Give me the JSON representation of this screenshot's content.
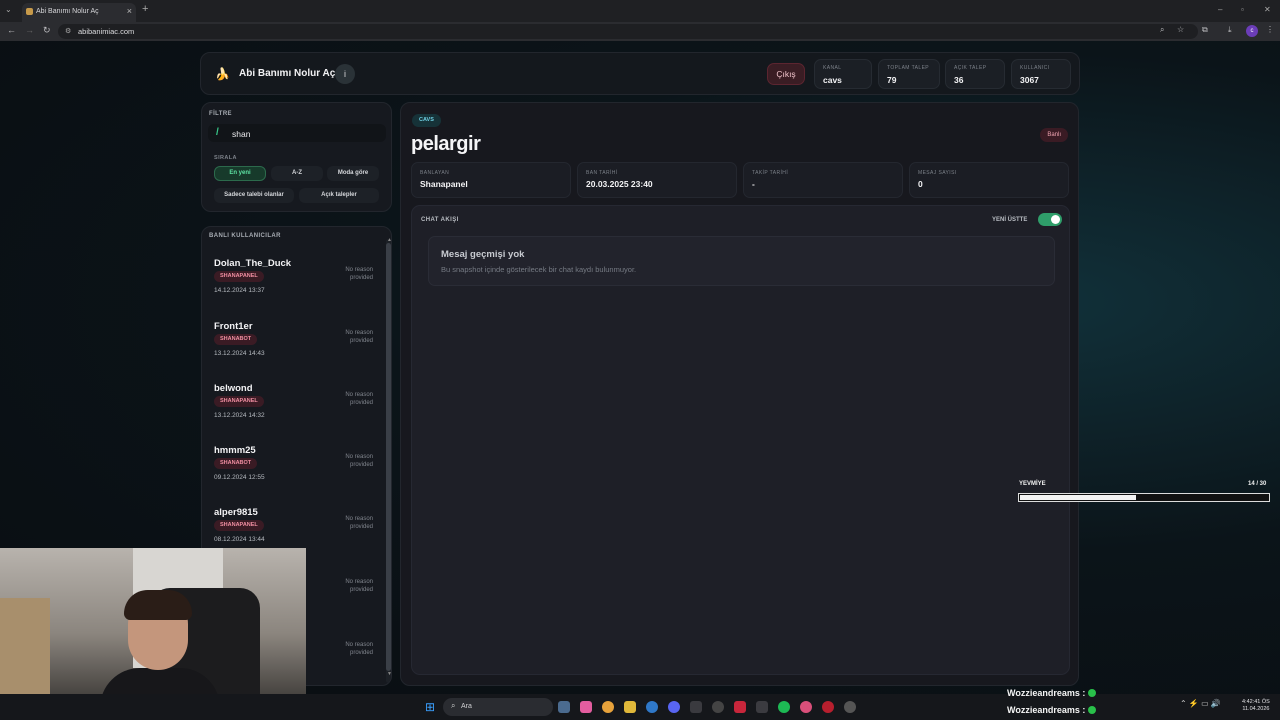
{
  "browser": {
    "tab_title": "Abi Banımı Nolur Aç",
    "url": "abibanimiac.com"
  },
  "header": {
    "emoji": "🍌",
    "title": "Abi Banımı Nolur Aç",
    "info_label": "i",
    "logout_label": "Çıkış",
    "stats": [
      {
        "label": "KANAL",
        "value": "cavs"
      },
      {
        "label": "TOPLAM TALEP",
        "value": "79"
      },
      {
        "label": "AÇIK TALEP",
        "value": "36"
      },
      {
        "label": "KULLANICI",
        "value": "3067"
      }
    ]
  },
  "filter": {
    "title": "FİLTRE",
    "prefix": "/",
    "value": "shan",
    "sort_title": "SIRALA",
    "sort_options": [
      "En yeni",
      "A-Z",
      "Moda göre"
    ],
    "active_sort": "En yeni",
    "extra_options": [
      "Sadece talebi olanlar",
      "Açık talepler"
    ]
  },
  "banned_users": {
    "title": "BANLI KULLANICILAR",
    "items": [
      {
        "name": "Dolan_The_Duck",
        "source": "SHANAPANEL",
        "date": "14.12.2024 13:37",
        "reason": "No reason provided"
      },
      {
        "name": "Front1er",
        "source": "SHANABOT",
        "date": "13.12.2024 14:43",
        "reason": "No reason provided"
      },
      {
        "name": "belwond",
        "source": "SHANAPANEL",
        "date": "13.12.2024 14:32",
        "reason": "No reason provided"
      },
      {
        "name": "hmmm25",
        "source": "SHANABOT",
        "date": "09.12.2024 12:55",
        "reason": "No reason provided"
      },
      {
        "name": "alper9815",
        "source": "SHANAPANEL",
        "date": "08.12.2024 13:44",
        "reason": "No reason provided"
      },
      {
        "name": "",
        "source": "",
        "date": "",
        "reason": "No reason provided"
      },
      {
        "name": "",
        "source": "",
        "date": "",
        "reason": "No reason provided"
      }
    ]
  },
  "detail": {
    "channel": "CAVS",
    "status": "Banlı",
    "username": "pelargir",
    "info": [
      {
        "label": "BANLAYAN",
        "value": "Shanapanel"
      },
      {
        "label": "BAN TARİHİ",
        "value": "20.03.2025 23:40"
      },
      {
        "label": "TAKİP TARİHİ",
        "value": "-"
      },
      {
        "label": "MESAJ SAYISI",
        "value": "0"
      }
    ],
    "chat": {
      "title": "CHAT AKIŞI",
      "newest_first_label": "YENİ ÜSTTE",
      "newest_first": true,
      "empty_title": "Mesaj geçmişi yok",
      "empty_desc": "Bu snapshot içinde gösterilecek bir chat kaydı bulunmuyor."
    }
  },
  "overlay": {
    "label": "YEVMİYE",
    "count_text": "14 / 30",
    "progress": 0.4667,
    "chat_lines": [
      "Wozzieandreams :",
      "Wozzieandreams :"
    ]
  },
  "taskbar": {
    "search_placeholder": "Ara",
    "time": "4:42:41 ÖS",
    "date": "11.04.2026"
  },
  "colors": {
    "accent_green": "#2f9e6a",
    "danger": "#f08ea1",
    "cyan": "#6fd0e3"
  }
}
